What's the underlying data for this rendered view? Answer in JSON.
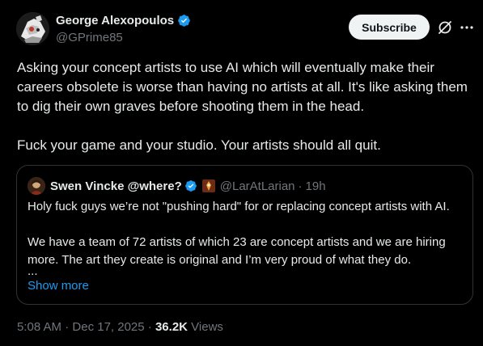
{
  "author": {
    "name": "George Alexopoulos",
    "handle": "@GPrime85"
  },
  "actions": {
    "subscribe_label": "Subscribe",
    "grok_icon": "grok-icon",
    "more_icon": "more-icon"
  },
  "post": {
    "paragraph_1": "Asking your concept artists to use AI which will eventually make their careers obsolete is worse than having no artists at all. It's like asking them to dig their own graves before shooting them in the head.",
    "paragraph_2": "Fuck your game and your studio. Your artists should all quit."
  },
  "quote": {
    "name": "Swen Vincke @where?",
    "handle": "@LarAtLarian",
    "separator": "·",
    "time": "19h",
    "paragraph_1": "Holy fuck guys we’re not \"pushing hard\" for or replacing concept artists with AI.",
    "paragraph_2": "We have a team of 72 artists of which 23 are concept artists and we are hiring more. The art they create is original and I’m very proud of what they do.",
    "ellipsis": "...",
    "show_more": "Show more"
  },
  "meta": {
    "time": "5:08 AM",
    "separator": "·",
    "date": "Dec 17, 2025",
    "views_count": "36.2K",
    "views_label": "Views"
  },
  "colors": {
    "background": "#000000",
    "text": "#e7e9ea",
    "muted": "#71767b",
    "accent": "#1d9bf0",
    "border": "#2f3336"
  }
}
